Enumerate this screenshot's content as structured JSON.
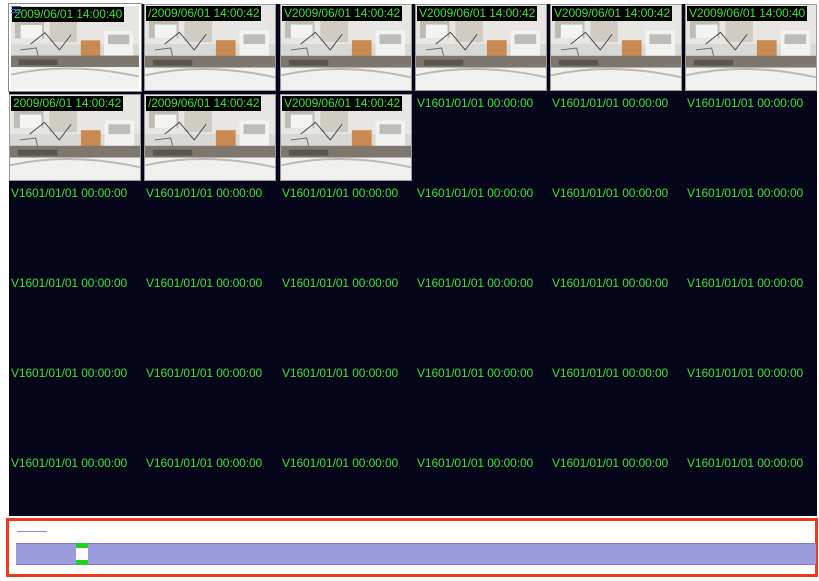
{
  "window": {
    "menu_icon": "hamburger-menu-icon"
  },
  "grid": {
    "columns": 6,
    "rows": 6,
    "tiles": [
      {
        "timestamp": "2009/06/01 14:00:40",
        "has_video": true,
        "selected": true
      },
      {
        "timestamp": "/2009/06/01 14:00:42",
        "has_video": true,
        "selected": false
      },
      {
        "timestamp": "V2009/06/01 14:00:42",
        "has_video": true,
        "selected": false
      },
      {
        "timestamp": "V2009/06/01 14:00:42",
        "has_video": true,
        "selected": false
      },
      {
        "timestamp": "V2009/06/01 14:00:42",
        "has_video": true,
        "selected": false
      },
      {
        "timestamp": "V2009/06/01 14:00:40",
        "has_video": true,
        "selected": false
      },
      {
        "timestamp": "2009/06/01 14:00:42",
        "has_video": true,
        "selected": false
      },
      {
        "timestamp": "/2009/06/01 14:00:42",
        "has_video": true,
        "selected": false
      },
      {
        "timestamp": "V2009/06/01 14:00:42",
        "has_video": true,
        "selected": false
      },
      {
        "timestamp": "V1601/01/01 00:00:00",
        "has_video": false,
        "selected": false
      },
      {
        "timestamp": "V1601/01/01 00:00:00",
        "has_video": false,
        "selected": false
      },
      {
        "timestamp": "V1601/01/01 00:00:00",
        "has_video": false,
        "selected": false
      },
      {
        "timestamp": "V1601/01/01 00:00:00",
        "has_video": false,
        "selected": false
      },
      {
        "timestamp": "V1601/01/01 00:00:00",
        "has_video": false,
        "selected": false
      },
      {
        "timestamp": "V1601/01/01 00:00:00",
        "has_video": false,
        "selected": false
      },
      {
        "timestamp": "V1601/01/01 00:00:00",
        "has_video": false,
        "selected": false
      },
      {
        "timestamp": "V1601/01/01 00:00:00",
        "has_video": false,
        "selected": false
      },
      {
        "timestamp": "V1601/01/01 00:00:00",
        "has_video": false,
        "selected": false
      },
      {
        "timestamp": "V1601/01/01 00:00:00",
        "has_video": false,
        "selected": false
      },
      {
        "timestamp": "V1601/01/01 00:00:00",
        "has_video": false,
        "selected": false
      },
      {
        "timestamp": "V1601/01/01 00:00:00",
        "has_video": false,
        "selected": false
      },
      {
        "timestamp": "V1601/01/01 00:00:00",
        "has_video": false,
        "selected": false
      },
      {
        "timestamp": "V1601/01/01 00:00:00",
        "has_video": false,
        "selected": false
      },
      {
        "timestamp": "V1601/01/01 00:00:00",
        "has_video": false,
        "selected": false
      },
      {
        "timestamp": "V1601/01/01 00:00:00",
        "has_video": false,
        "selected": false
      },
      {
        "timestamp": "V1601/01/01 00:00:00",
        "has_video": false,
        "selected": false
      },
      {
        "timestamp": "V1601/01/01 00:00:00",
        "has_video": false,
        "selected": false
      },
      {
        "timestamp": "V1601/01/01 00:00:00",
        "has_video": false,
        "selected": false
      },
      {
        "timestamp": "V1601/01/01 00:00:00",
        "has_video": false,
        "selected": false
      },
      {
        "timestamp": "V1601/01/01 00:00:00",
        "has_video": false,
        "selected": false
      },
      {
        "timestamp": "V1601/01/01 00:00:00",
        "has_video": false,
        "selected": false
      },
      {
        "timestamp": "V1601/01/01 00:00:00",
        "has_video": false,
        "selected": false
      },
      {
        "timestamp": "V1601/01/01 00:00:00",
        "has_video": false,
        "selected": false
      },
      {
        "timestamp": "V1601/01/01 00:00:00",
        "has_video": false,
        "selected": false
      },
      {
        "timestamp": "V1601/01/01 00:00:00",
        "has_video": false,
        "selected": false
      },
      {
        "timestamp": "V1601/01/01 00:00:00",
        "has_video": false,
        "selected": false
      }
    ]
  },
  "timeline": {
    "playhead_position": 0.075
  },
  "colors": {
    "grid_background": "#06061a",
    "timestamp_text": "#3ce23c",
    "timeline_frame": "#ee3a1c",
    "timeline_track": "#9c9cdc",
    "playhead": "#22d022"
  }
}
